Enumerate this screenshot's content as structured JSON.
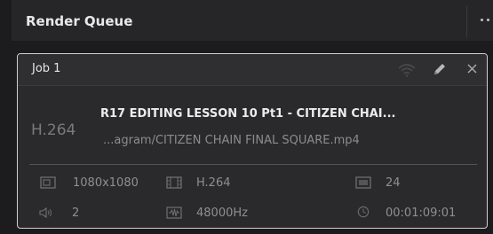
{
  "panel": {
    "title": "Render Queue"
  },
  "job": {
    "name": "Job 1",
    "codec_display": "H.264",
    "title": "R17 EDITING LESSON 10 Pt1 - CITIZEN CHAI...",
    "path": "...agram/CITIZEN CHAIN FINAL SQUARE.mp4",
    "specs": {
      "resolution": "1080x1080",
      "codec": "H.264",
      "framerate": "24",
      "audio_channels": "2",
      "sample_rate": "48000Hz",
      "duration": "00:01:09:01"
    }
  },
  "icons": {
    "more": "more-icon",
    "remote": "wifi-icon",
    "edit": "pencil-icon",
    "close": "close-icon",
    "resolution": "frame-size-icon",
    "codec": "film-codec-icon",
    "framerate": "frame-rate-icon",
    "audio": "speaker-icon",
    "waveform": "waveform-icon",
    "duration": "clock-icon"
  },
  "colors": {
    "background": "#1c1c1e",
    "card": "#2a2a2c",
    "card_border": "#cfcfcf",
    "text_primary": "#ececec",
    "text_muted": "#8f8f91"
  }
}
